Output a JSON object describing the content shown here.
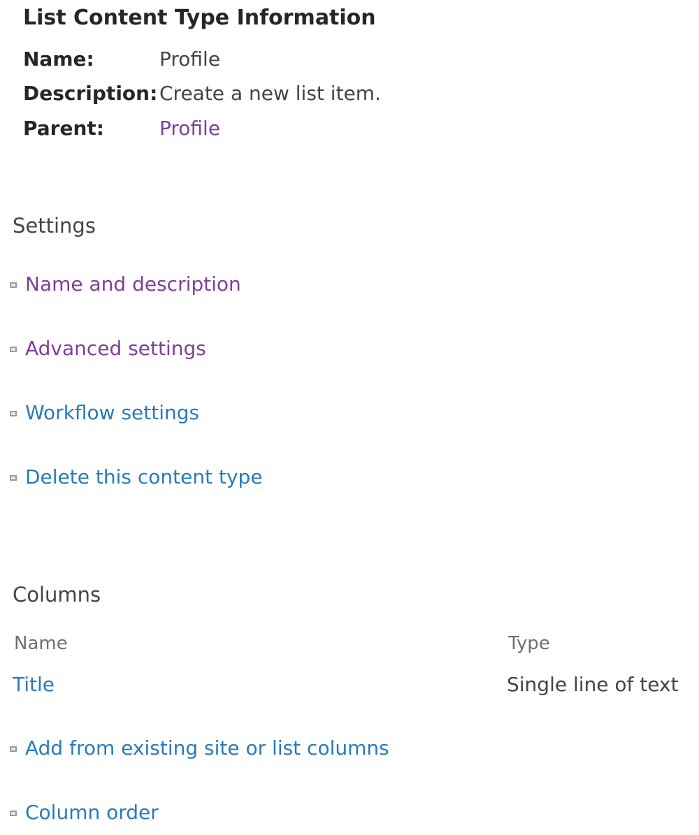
{
  "info": {
    "title": "List Content Type Information",
    "rows": [
      {
        "label": "Name:",
        "value": "Profile"
      },
      {
        "label": "Description:",
        "value": "Create a new list item."
      },
      {
        "label": "Parent:",
        "value": "Profile"
      }
    ]
  },
  "settings": {
    "heading": "Settings",
    "links": [
      {
        "label": "Name and description"
      },
      {
        "label": "Advanced settings"
      },
      {
        "label": "Workflow settings"
      },
      {
        "label": "Delete this content type"
      }
    ]
  },
  "columns": {
    "heading": "Columns",
    "headers": {
      "name": "Name",
      "type": "Type"
    },
    "rows": [
      {
        "name": "Title",
        "type": "Single line of text"
      }
    ],
    "links": [
      {
        "label": "Add from existing site or list columns"
      },
      {
        "label": "Column order"
      }
    ]
  },
  "colors": {
    "visited_link": "#7f3f98",
    "link": "#2a7ab8",
    "heading_text": "#262626",
    "body_text": "#444444",
    "column_header_text": "#707070"
  }
}
